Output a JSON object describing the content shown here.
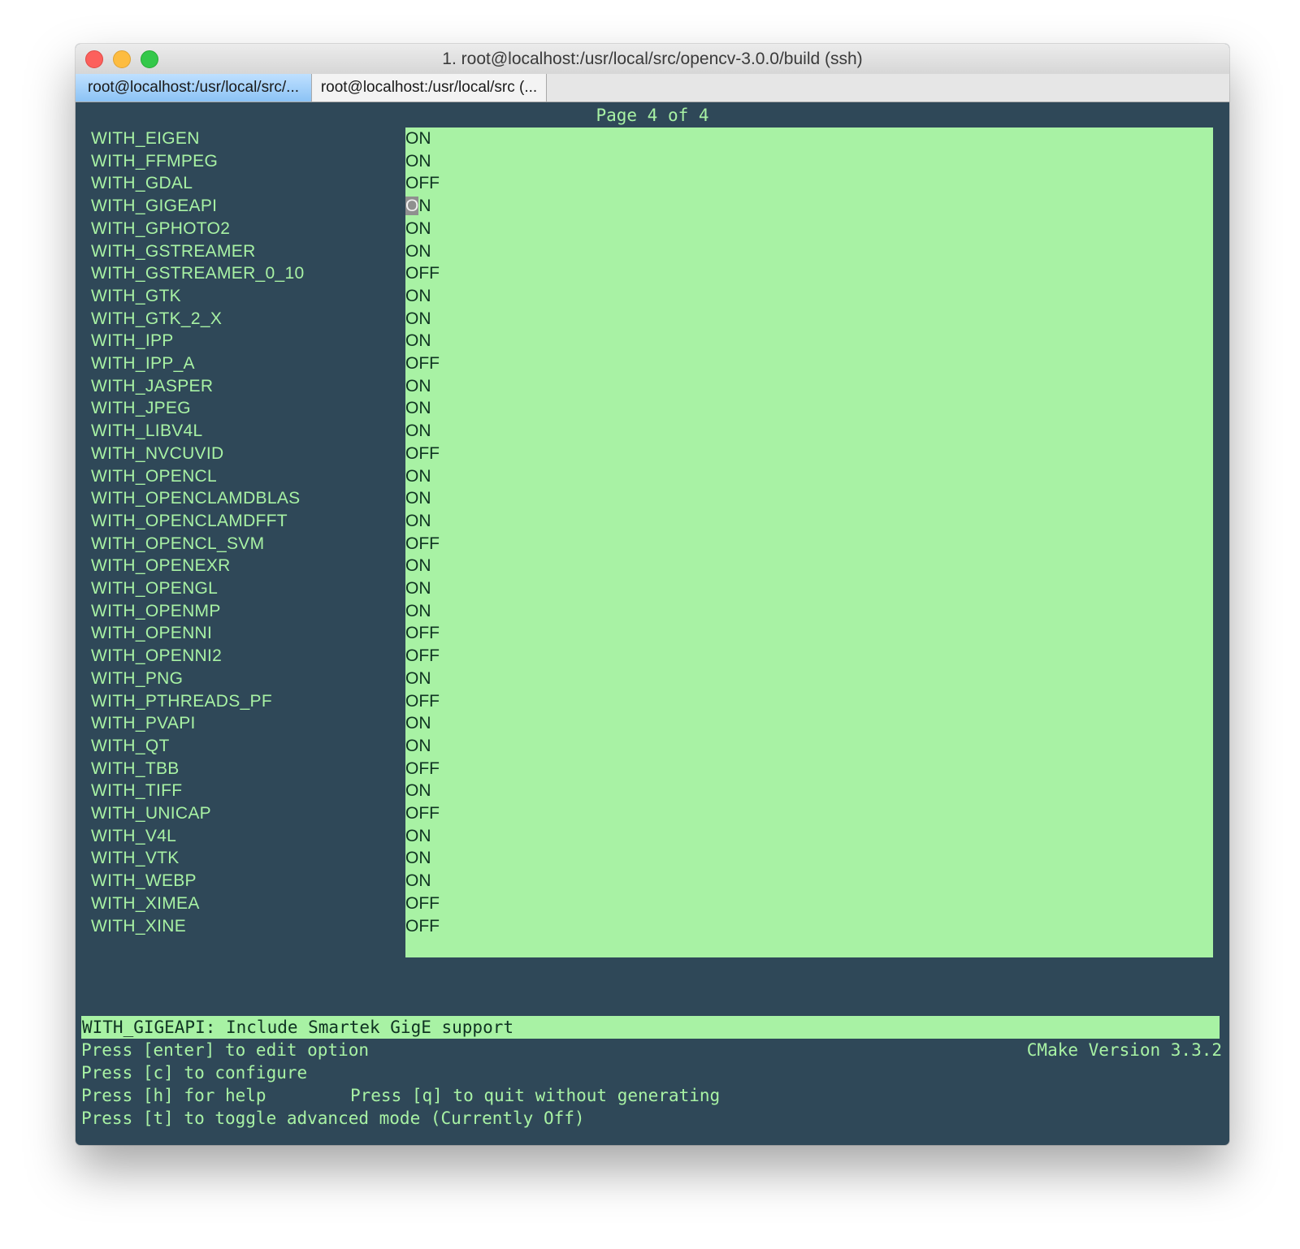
{
  "window": {
    "title": "1. root@localhost:/usr/local/src/opencv-3.0.0/build (ssh)",
    "tabs": [
      {
        "label": "root@localhost:/usr/local/src/..."
      },
      {
        "label": "root@localhost:/usr/local/src (..."
      }
    ]
  },
  "terminal": {
    "page_header": "Page 4 of 4",
    "options": [
      {
        "name": "WITH_EIGEN",
        "value": "ON"
      },
      {
        "name": "WITH_FFMPEG",
        "value": "ON"
      },
      {
        "name": "WITH_GDAL",
        "value": "OFF"
      },
      {
        "name": "WITH_GIGEAPI",
        "value": "ON",
        "cursor": true
      },
      {
        "name": "WITH_GPHOTO2",
        "value": "ON"
      },
      {
        "name": "WITH_GSTREAMER",
        "value": "ON"
      },
      {
        "name": "WITH_GSTREAMER_0_10",
        "value": "OFF"
      },
      {
        "name": "WITH_GTK",
        "value": "ON"
      },
      {
        "name": "WITH_GTK_2_X",
        "value": "ON"
      },
      {
        "name": "WITH_IPP",
        "value": "ON"
      },
      {
        "name": "WITH_IPP_A",
        "value": "OFF"
      },
      {
        "name": "WITH_JASPER",
        "value": "ON"
      },
      {
        "name": "WITH_JPEG",
        "value": "ON"
      },
      {
        "name": "WITH_LIBV4L",
        "value": "ON"
      },
      {
        "name": "WITH_NVCUVID",
        "value": "OFF"
      },
      {
        "name": "WITH_OPENCL",
        "value": "ON"
      },
      {
        "name": "WITH_OPENCLAMDBLAS",
        "value": "ON"
      },
      {
        "name": "WITH_OPENCLAMDFFT",
        "value": "ON"
      },
      {
        "name": "WITH_OPENCL_SVM",
        "value": "OFF"
      },
      {
        "name": "WITH_OPENEXR",
        "value": "ON"
      },
      {
        "name": "WITH_OPENGL",
        "value": "ON"
      },
      {
        "name": "WITH_OPENMP",
        "value": "ON"
      },
      {
        "name": "WITH_OPENNI",
        "value": "OFF"
      },
      {
        "name": "WITH_OPENNI2",
        "value": "OFF"
      },
      {
        "name": "WITH_PNG",
        "value": "ON"
      },
      {
        "name": "WITH_PTHREADS_PF",
        "value": "OFF"
      },
      {
        "name": "WITH_PVAPI",
        "value": "ON"
      },
      {
        "name": "WITH_QT",
        "value": "ON"
      },
      {
        "name": "WITH_TBB",
        "value": "OFF"
      },
      {
        "name": "WITH_TIFF",
        "value": "ON"
      },
      {
        "name": "WITH_UNICAP",
        "value": "OFF"
      },
      {
        "name": "WITH_V4L",
        "value": "ON"
      },
      {
        "name": "WITH_VTK",
        "value": "ON"
      },
      {
        "name": "WITH_WEBP",
        "value": "ON"
      },
      {
        "name": "WITH_XIMEA",
        "value": "OFF"
      },
      {
        "name": "WITH_XINE",
        "value": "OFF"
      }
    ],
    "description": "WITH_GIGEAPI: Include Smartek GigE support",
    "help": {
      "enter": "Press [enter] to edit option",
      "version": "CMake Version 3.3.2",
      "configure": "Press [c] to configure",
      "help": "Press [h] for help",
      "quit": "Press [q] to quit without generating",
      "toggle": "Press [t] to toggle advanced mode (Currently Off)"
    }
  },
  "colors": {
    "terminal_bg": "#2f4858",
    "accent_green": "#a8f2a4",
    "value_text": "#0f3322"
  }
}
